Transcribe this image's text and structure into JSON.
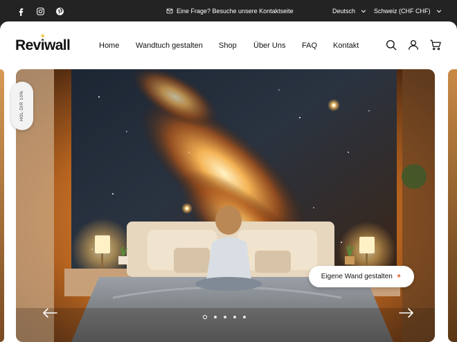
{
  "topbar": {
    "social": [
      {
        "name": "facebook-icon"
      },
      {
        "name": "instagram-icon"
      },
      {
        "name": "pinterest-icon"
      }
    ],
    "announcement": "Eine Frage? Besuche unsere Kontaktseite",
    "language": "Deutsch",
    "country": "Schweiz (CHF CHF)"
  },
  "header": {
    "logo": "Reviwall",
    "nav": [
      "Home",
      "Wandtuch gestalten",
      "Shop",
      "Über Uns",
      "FAQ",
      "Kontakt"
    ],
    "icons": [
      "search-icon",
      "account-icon",
      "cart-icon"
    ]
  },
  "hero": {
    "side_tab": "HOL DIR 10%",
    "cta_label": "Eigene Wand gestalten",
    "cta_icon": "magic-wand-icon",
    "slide_count": 5,
    "active_slide": 1
  },
  "colors": {
    "topbar_bg": "#232323",
    "header_bg": "#ffffff",
    "accent_star": "#f2c230"
  }
}
